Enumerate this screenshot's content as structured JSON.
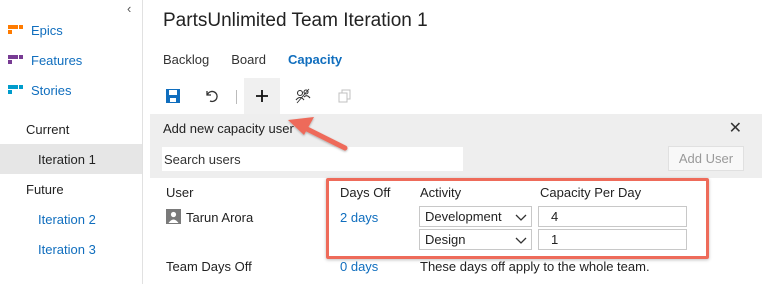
{
  "sidebar": {
    "backlog_items": [
      {
        "label": "Epics",
        "icon": "epic-icon",
        "color": "#ff7b00"
      },
      {
        "label": "Features",
        "icon": "feature-icon",
        "color": "#773b93"
      },
      {
        "label": "Stories",
        "icon": "story-icon",
        "color": "#009ccc"
      }
    ],
    "current_label": "Current",
    "current_iteration": "Iteration 1",
    "future_label": "Future",
    "future_iterations": [
      "Iteration 2",
      "Iteration 3"
    ]
  },
  "header": {
    "title": "PartsUnlimited Team Iteration 1"
  },
  "tabs": [
    {
      "label": "Backlog",
      "active": false
    },
    {
      "label": "Board",
      "active": false
    },
    {
      "label": "Capacity",
      "active": true
    }
  ],
  "toolbar": {
    "icons": [
      "save-icon",
      "undo-icon",
      "add-icon",
      "copy-team-icon",
      "copy-icon"
    ]
  },
  "add_panel": {
    "header": "Add new capacity user",
    "search_placeholder": "Search users",
    "add_user_label": "Add User"
  },
  "grid": {
    "columns": {
      "user": "User",
      "days_off": "Days Off",
      "activity": "Activity",
      "capacity": "Capacity Per Day"
    },
    "rows": [
      {
        "user": "Tarun Arora",
        "days_off": "2 days",
        "activities": [
          {
            "activity": "Development",
            "capacity": "4"
          },
          {
            "activity": "Design",
            "capacity": "1"
          }
        ]
      }
    ],
    "team_days_off_label": "Team Days Off",
    "team_days_off_value": "0 days",
    "team_days_off_note": "These days off apply to the whole team."
  },
  "colors": {
    "accent": "#106ebe",
    "highlight": "#ee6b5a",
    "panel_bg": "#eeeeee"
  }
}
